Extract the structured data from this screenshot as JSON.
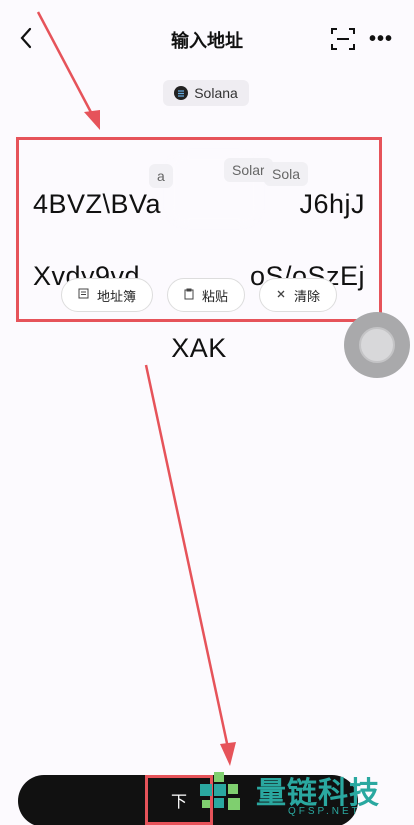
{
  "header": {
    "title": "输入地址",
    "back_icon": "chevron-left-icon",
    "scan_icon": "scan-icon",
    "more_label": "•••"
  },
  "network": {
    "label": "Solana",
    "icon": "solana-icon"
  },
  "address": {
    "line1": "4BVZ\\BVa",
    "line1_end": "J6hjJ",
    "line2": "Xvdy9vd",
    "line2_end": "oS/oSzEj",
    "line3": "XAK",
    "ghost_tags": [
      "a",
      "Solar",
      "Sola"
    ]
  },
  "chips": [
    {
      "label": "地址簿",
      "icon": "address-book-icon"
    },
    {
      "label": "粘贴",
      "icon": "paste-icon"
    },
    {
      "label": "清除",
      "icon": "clear-icon"
    }
  ],
  "next_button": {
    "label": "下"
  },
  "watermark": {
    "title": "量链科技",
    "subtitle": "QFSP.NET"
  },
  "colors": {
    "annotation_red": "#e6535a",
    "watermark_teal": "#2aa8a0",
    "button_dark": "#111111"
  }
}
